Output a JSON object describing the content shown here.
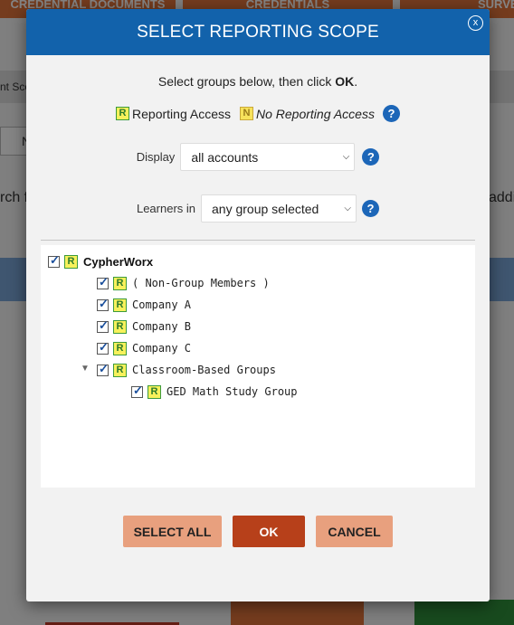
{
  "background": {
    "tabs": [
      "CREDENTIAL DOCUMENTS",
      "CREDENTIALS",
      "SURVEYS"
    ],
    "left_label": "nt Sco",
    "search_fragment": "rch f",
    "right_fragment": "addi",
    "n_fragment": "N"
  },
  "modal": {
    "title": "SELECT REPORTING SCOPE",
    "close_label": "x",
    "instructions_prefix": "Select groups below, then click ",
    "instructions_ok": "OK",
    "instructions_suffix": ".",
    "legend": {
      "access_badge": "R",
      "access_label": "Reporting Access",
      "no_access_badge": "N",
      "no_access_label": "No Reporting Access",
      "help": "?"
    },
    "display": {
      "label": "Display",
      "value": "all accounts",
      "help": "?"
    },
    "learners": {
      "label": "Learners in",
      "value": "any group selected",
      "help": "?"
    },
    "tree": [
      {
        "label": "CypherWorx",
        "badge": "R",
        "level": 0,
        "checked": true
      },
      {
        "label": "( Non-Group Members )",
        "badge": "R",
        "level": 1,
        "checked": true
      },
      {
        "label": "Company A",
        "badge": "R",
        "level": 1,
        "checked": true
      },
      {
        "label": "Company B",
        "badge": "R",
        "level": 1,
        "checked": true
      },
      {
        "label": "Company C",
        "badge": "R",
        "level": 1,
        "checked": true
      },
      {
        "label": "Classroom-Based Groups",
        "badge": "R",
        "level": 1,
        "checked": true,
        "expanded": true
      },
      {
        "label": "GED Math Study Group",
        "badge": "R",
        "level": 2,
        "checked": true
      }
    ],
    "buttons": {
      "select_all": "SELECT ALL",
      "ok": "OK",
      "cancel": "CANCEL"
    }
  }
}
